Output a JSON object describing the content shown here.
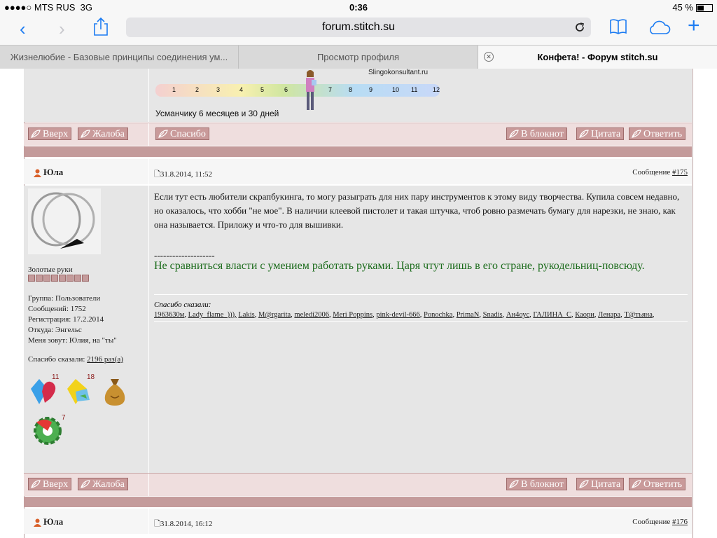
{
  "status_bar": {
    "carrier": "MTS RUS",
    "network": "3G",
    "time": "0:36",
    "battery": "45 %"
  },
  "toolbar": {
    "url": "forum.stitch.su"
  },
  "tabs": [
    {
      "label": "Жизнелюбие - Базовые принципы соединения ум..."
    },
    {
      "label": "Просмотр профиля"
    },
    {
      "label": "Конфета! - Форум stitch.su"
    }
  ],
  "signature": {
    "brand": "Slingokonsultant.ru",
    "months": [
      "1",
      "2",
      "3",
      "4",
      "5",
      "6",
      "7",
      "8",
      "9",
      "10",
      "11",
      "12"
    ],
    "text": "Усманчику 6 месяцев и 30 дней"
  },
  "buttons": {
    "up": "Вверх",
    "report": "Жалоба",
    "thanks": "Спасибо",
    "notepad": "В блокнот",
    "quote": "Цитата",
    "reply": "Ответить"
  },
  "post1": {
    "author": "Юла",
    "date": "31.8.2014, 11:52",
    "number_label": "Сообщение",
    "number": "#175",
    "rank": "Золотые руки",
    "group": "Группа: Пользователи",
    "messages": "Сообщений: 1752",
    "registered": "Регистрация: 17.2.2014",
    "location": "Откуда: Энгельс",
    "call_me": "Меня зовут: Юлия, на \"ты\"",
    "thanks_said_label": "Спасибо сказали:",
    "thanks_said_count": "2196 раз(а)",
    "awards": [
      {
        "name": "heart-diamond",
        "count": "11"
      },
      {
        "name": "yellow-diamond",
        "count": "18"
      },
      {
        "name": "money-bag",
        "count": ""
      },
      {
        "name": "gear-award",
        "count": "7"
      }
    ],
    "text": "Если тут есть любители скрапбукинга, то могу разыграть для них пару инструментов к этому виду творчества. Купила совсем недавно, но оказалось, что хобби \"не мое\". В наличии клеевой пистолет и такая штучка, чтоб ровно размечать бумагу для нарезки, не знаю, как она называется. Приложу и что-то для вышивки.",
    "separator": "--------------------",
    "motto": "Не сравниться власти с умением работать руками. Царя чтут лишь в его стране, рукодельниц-повсюду.",
    "thanks_title": "Спасибо сказали:",
    "thanks_users": [
      "1963630м",
      "Lady_flame_))),",
      "Lakis",
      "M@rgarita",
      "meledi2006",
      "Meri Poppins",
      "pink-devil-666",
      "Ponochka",
      "PrimaN",
      "Snadis",
      "Ан4оус",
      "ГАЛИНА_С",
      "Каори",
      "Ленара",
      "Т@тьяна"
    ]
  },
  "post2": {
    "author": "Юла",
    "date": "31.8.2014, 16:12",
    "number_label": "Сообщение",
    "number": "#176"
  },
  "colors": {
    "accent": "#1d7cf2",
    "forum_button": "#c99a9a",
    "separator": "#c49b9b",
    "motto": "#1a6b1a"
  }
}
